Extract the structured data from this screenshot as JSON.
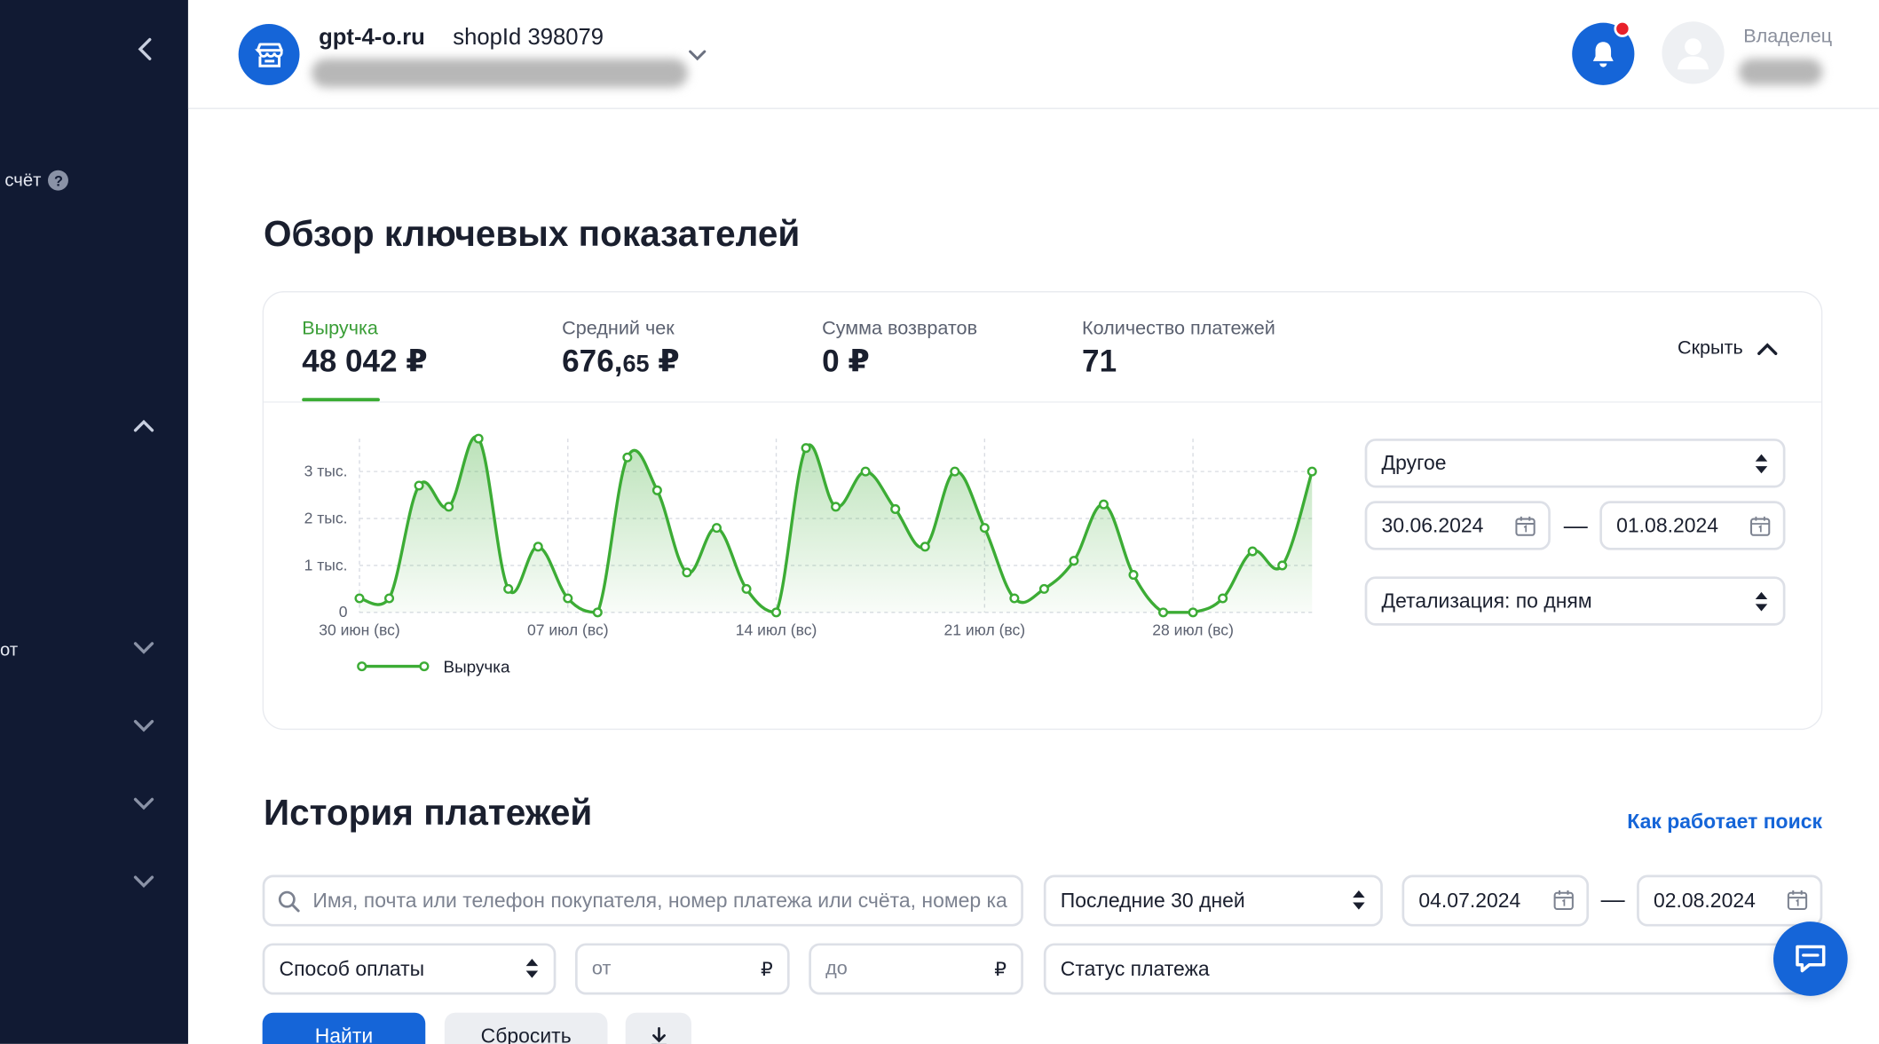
{
  "sidebar": {
    "account_label": "счёт",
    "help_glyph": "?",
    "report_label": "от",
    "icons": [
      "chevron-left-icon",
      "help-icon",
      "chevron-up-icon",
      "chevron-down-icon"
    ]
  },
  "header": {
    "shop_name": "gpt-4-o.ru",
    "shop_id": "shopId 398079",
    "role": "Владелец",
    "notification_badge": true,
    "colors": {
      "brand": "#1565d8",
      "badge": "#e8202a"
    }
  },
  "overview": {
    "title": "Обзор ключевых показателей",
    "hide_label": "Скрыть",
    "metrics": [
      {
        "label": "Выручка",
        "value": "48 042 ₽",
        "active": true
      },
      {
        "label": "Средний чек",
        "value_main": "676,",
        "value_cents": "65",
        "value_currency": " ₽"
      },
      {
        "label": "Сумма возвратов",
        "value": "0 ₽"
      },
      {
        "label": "Количество платежей",
        "value": "71"
      }
    ],
    "period_select": "Другое",
    "date_from": "30.06.2024",
    "date_to": "01.08.2024",
    "date_sep": "—",
    "detail_select": "Детализация: по дням"
  },
  "chart_data": {
    "type": "area",
    "title": "",
    "xlabel": "",
    "ylabel": "",
    "y_tick_labels": [
      "0",
      "1 тыс.",
      "2 тыс.",
      "3 тыс."
    ],
    "y_tick_values": [
      0,
      1000,
      2000,
      3000
    ],
    "ylim": [
      0,
      3700
    ],
    "x_tick_labels": [
      "30 июн (вс)",
      "07 июл (вс)",
      "14 июл (вс)",
      "21 июл (вс)",
      "28 июл (вс)"
    ],
    "x_tick_index": [
      0,
      7,
      14,
      21,
      28
    ],
    "x": [
      "30 июн",
      "01 июл",
      "02 июл",
      "03 июл",
      "04 июл",
      "05 июл",
      "06 июл",
      "07 июл",
      "08 июл",
      "09 июл",
      "10 июл",
      "11 июл",
      "12 июл",
      "13 июл",
      "14 июл",
      "15 июл",
      "16 июл",
      "17 июл",
      "18 июл",
      "19 июл",
      "20 июл",
      "21 июл",
      "22 июл",
      "23 июл",
      "24 июл",
      "25 июл",
      "26 июл",
      "27 июл",
      "28 июл",
      "29 июл",
      "30 июл",
      "31 июл",
      "01 авг"
    ],
    "series": [
      {
        "name": "Выручка",
        "color": "#3cac35",
        "values": [
          300,
          300,
          2700,
          2250,
          3700,
          500,
          1400,
          300,
          0,
          3300,
          2600,
          850,
          1800,
          500,
          0,
          3500,
          2250,
          3000,
          2200,
          1400,
          3000,
          1800,
          300,
          500,
          1100,
          2300,
          800,
          0,
          0,
          300,
          1300,
          1000,
          3000
        ]
      }
    ],
    "legend": "bottom-left",
    "grid": true
  },
  "history": {
    "title": "История платежей",
    "how_search_link": "Как работает поиск",
    "search_placeholder": "Имя, почта или телефон покупателя, номер платежа или счёта, номер карты",
    "period_select": "Последние 30 дней",
    "date_from": "04.07.2024",
    "date_to": "02.08.2024",
    "date_sep": "—",
    "payment_method": "Способ оплаты",
    "amount_from_placeholder": "от",
    "amount_to_placeholder": "до",
    "currency": "₽",
    "status": "Статус платежа",
    "find_button": "Найти",
    "reset_button": "Сбросить"
  }
}
